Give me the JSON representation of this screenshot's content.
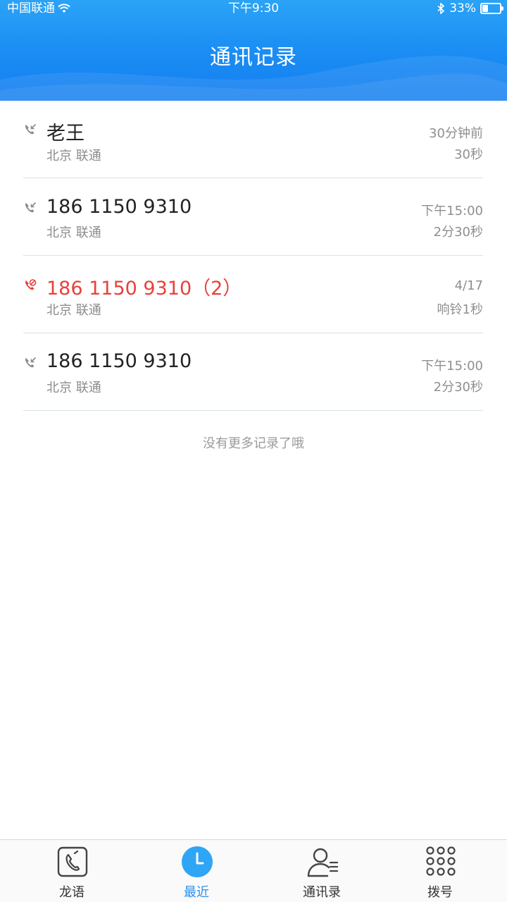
{
  "status_bar": {
    "carrier": "中国联通",
    "time": "下午9:30",
    "battery": "33%",
    "battery_level": 0.33
  },
  "header": {
    "title": "通讯记录"
  },
  "calls": [
    {
      "name": "老王",
      "location": "北京 联通",
      "time": "30分钟前",
      "duration": "30秒",
      "missed": false
    },
    {
      "name": "186 1150 9310",
      "location": "北京 联通",
      "time": "下午15:00",
      "duration": "2分30秒",
      "missed": false
    },
    {
      "name": "186 1150 9310（2）",
      "location": "北京 联通",
      "time": "4/17",
      "duration": "响铃1秒",
      "missed": true
    },
    {
      "name": "186 1150 9310",
      "location": "北京 联通",
      "time": "下午15:00",
      "duration": "2分30秒",
      "missed": false
    }
  ],
  "footer_note": "没有更多记录了哦",
  "tabs": [
    {
      "label": "龙语",
      "icon": "phone-card-icon",
      "active": false
    },
    {
      "label": "最近",
      "icon": "clock-icon",
      "active": true
    },
    {
      "label": "通讯录",
      "icon": "contacts-icon",
      "active": false
    },
    {
      "label": "拨号",
      "icon": "dialpad-icon",
      "active": false
    }
  ],
  "colors": {
    "accent": "#2b8ef0",
    "missed": "#e8413c",
    "header": "#1a8cf3"
  }
}
